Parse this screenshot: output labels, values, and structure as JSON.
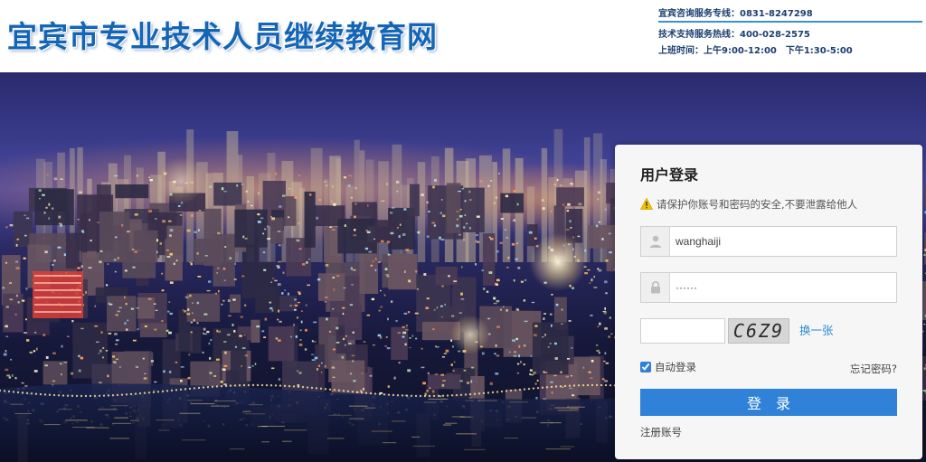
{
  "header": {
    "site_title": "宜宾市专业技术人员继续教育网",
    "consult_line": "宜宾咨询服务专线：0831-8247298",
    "support_line": "技术支持服务热线：400-028-2575",
    "hours_line": "上班时间：上午9:00-12:00　下午1:30-5:00"
  },
  "login": {
    "title": "用户登录",
    "hint": "请保护你账号和密码的安全,不要泄露给他人",
    "username_value": "wanghaiji",
    "password_value": "······",
    "captcha_value": "",
    "captcha_text": "C6Z9",
    "refresh_label": "换一张",
    "remember_label": "自动登录",
    "remember_checked": true,
    "forgot_label": "忘记密码?",
    "submit_label": "登录",
    "register_label": "注册账号"
  },
  "colors": {
    "title_blue": "#1565b5",
    "button_blue": "#2f82d8",
    "link_blue": "#2a8ad4"
  },
  "icons": {
    "warning": "warning-icon",
    "user": "user-icon",
    "lock": "lock-icon"
  }
}
